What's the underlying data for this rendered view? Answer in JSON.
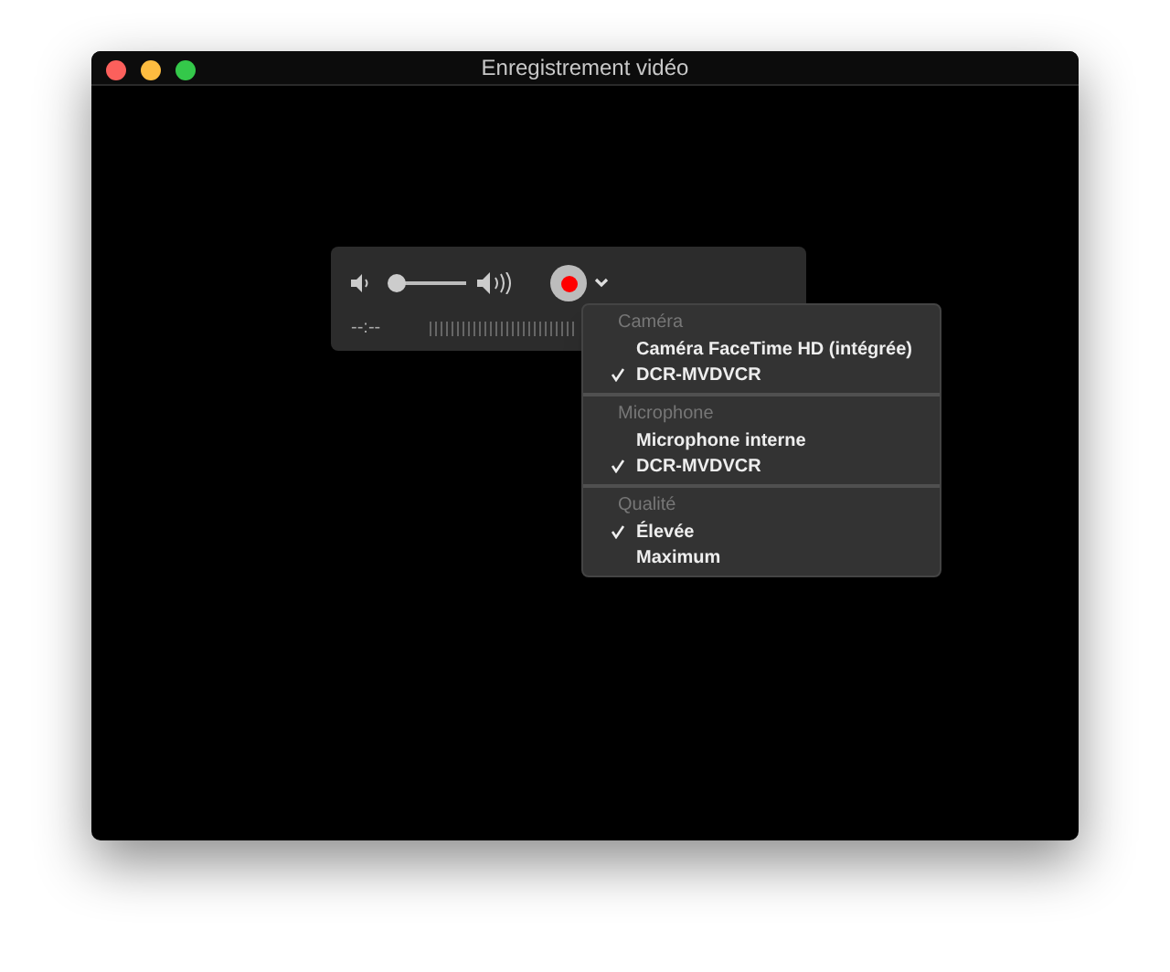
{
  "window": {
    "title": "Enregistrement vidéo"
  },
  "controls": {
    "volume": {
      "level": 0.1
    },
    "time": "--:--"
  },
  "menu": {
    "sections": [
      {
        "header": "Caméra",
        "items": [
          {
            "label": "Caméra FaceTime HD (intégrée)",
            "selected": false
          },
          {
            "label": "DCR-MVDVCR",
            "selected": true
          }
        ]
      },
      {
        "header": "Microphone",
        "items": [
          {
            "label": "Microphone interne",
            "selected": false
          },
          {
            "label": "DCR-MVDVCR",
            "selected": true
          }
        ]
      },
      {
        "header": "Qualité",
        "items": [
          {
            "label": "Élevée",
            "selected": true
          },
          {
            "label": "Maximum",
            "selected": false
          }
        ]
      }
    ]
  }
}
